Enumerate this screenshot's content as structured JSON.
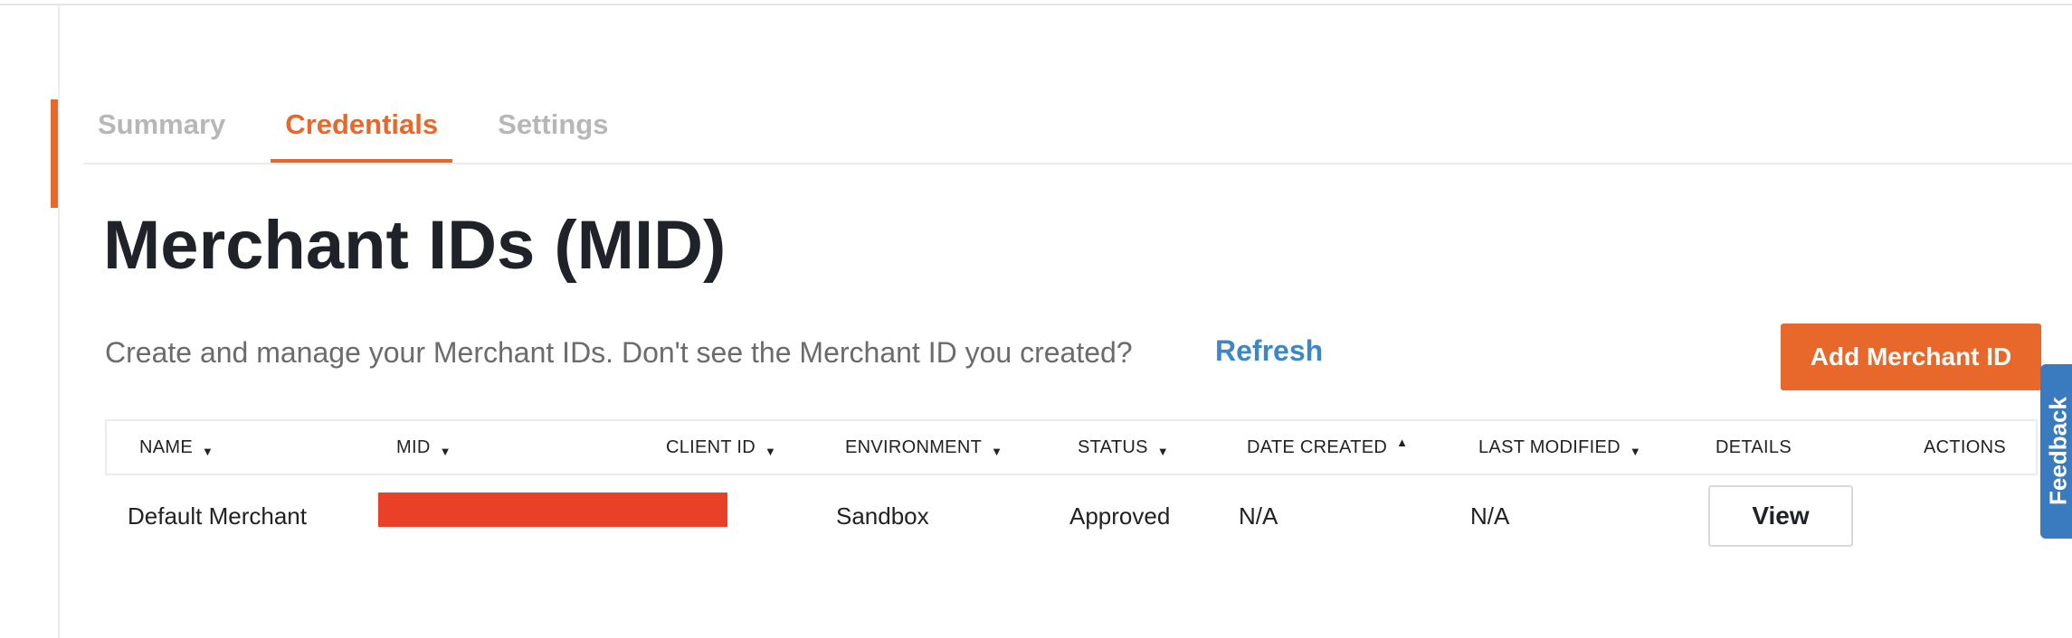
{
  "tabs": [
    {
      "label": "Summary",
      "active": false
    },
    {
      "label": "Credentials",
      "active": true
    },
    {
      "label": "Settings",
      "active": false
    }
  ],
  "page": {
    "title": "Merchant IDs (MID)",
    "intro": "Create and manage your Merchant IDs. Don't see the Merchant ID you created?",
    "refresh_label": "Refresh",
    "add_button_label": "Add Merchant ID"
  },
  "feedback": {
    "label": "Feedback"
  },
  "table": {
    "columns": [
      {
        "label": "NAME",
        "sort": "down"
      },
      {
        "label": "MID",
        "sort": "down"
      },
      {
        "label": "CLIENT ID",
        "sort": "down"
      },
      {
        "label": "ENVIRONMENT",
        "sort": "down"
      },
      {
        "label": "STATUS",
        "sort": "down"
      },
      {
        "label": "DATE CREATED",
        "sort": "up"
      },
      {
        "label": "LAST MODIFIED",
        "sort": "down"
      },
      {
        "label": "DETAILS",
        "sort": ""
      },
      {
        "label": "ACTIONS",
        "sort": ""
      }
    ],
    "rows": [
      {
        "name": "Default Merchant",
        "mid": "",
        "client_id": "",
        "environment": "Sandbox",
        "status": "Approved",
        "date_created": "N/A",
        "last_modified": "N/A",
        "details_label": "View",
        "actions": ""
      }
    ]
  },
  "colors": {
    "accent": "#e8672a",
    "link": "#3c87c5",
    "redaction": "#e94128",
    "feedback": "#3a7bbf"
  },
  "icons": {
    "sort_down": "caret-down-icon",
    "sort_up": "caret-up-icon"
  }
}
